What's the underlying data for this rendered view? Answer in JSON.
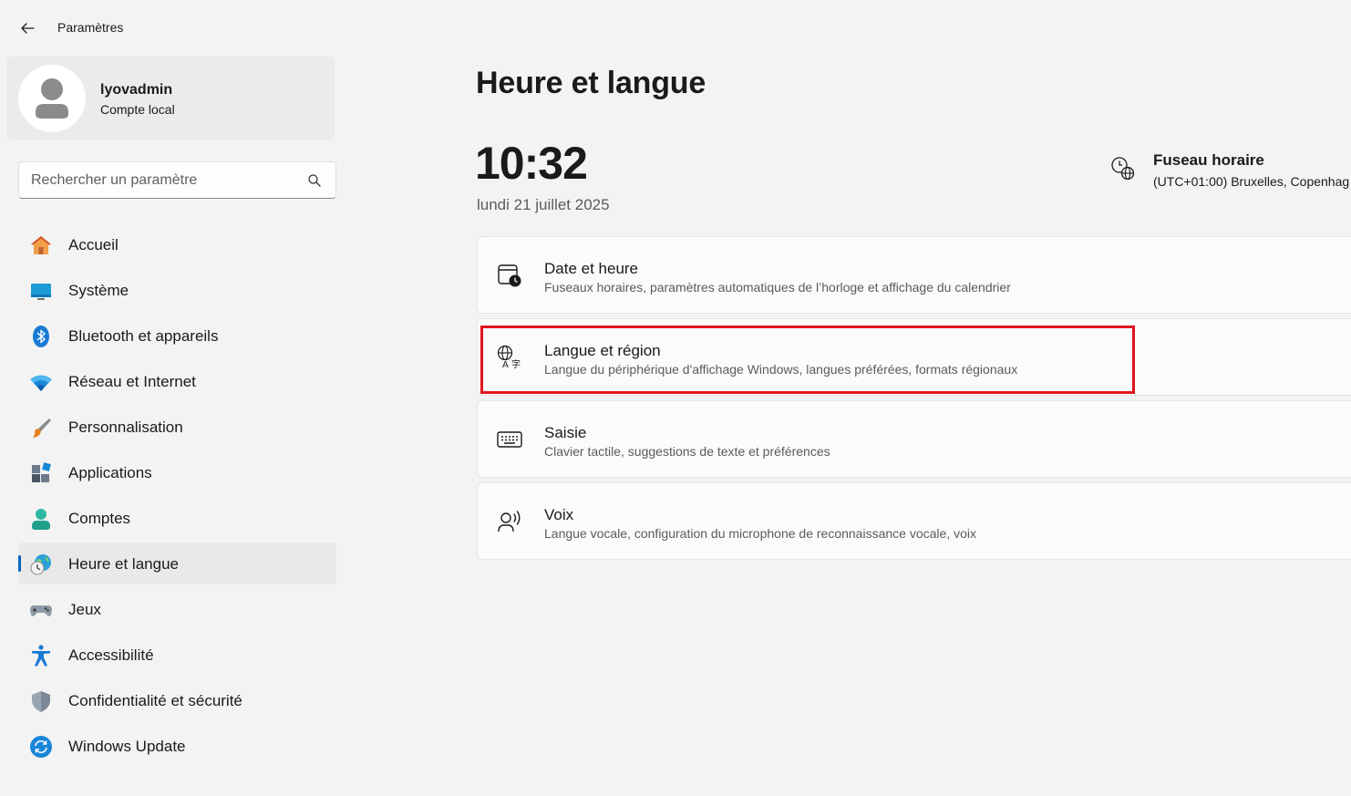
{
  "app": {
    "title": "Paramètres",
    "back_icon": "back-arrow-icon"
  },
  "profile": {
    "name": "lyovadmin",
    "account_type": "Compte local"
  },
  "search": {
    "placeholder": "Rechercher un paramètre",
    "value": ""
  },
  "sidebar": {
    "items": [
      {
        "label": "Accueil",
        "icon": "home-icon",
        "active": false
      },
      {
        "label": "Système",
        "icon": "display-icon",
        "active": false
      },
      {
        "label": "Bluetooth et appareils",
        "icon": "bluetooth-icon",
        "active": false
      },
      {
        "label": "Réseau et Internet",
        "icon": "wifi-icon",
        "active": false
      },
      {
        "label": "Personnalisation",
        "icon": "brush-icon",
        "active": false
      },
      {
        "label": "Applications",
        "icon": "apps-icon",
        "active": false
      },
      {
        "label": "Comptes",
        "icon": "person-icon",
        "active": false
      },
      {
        "label": "Heure et langue",
        "icon": "globe-clock-icon",
        "active": true
      },
      {
        "label": "Jeux",
        "icon": "gamepad-icon",
        "active": false
      },
      {
        "label": "Accessibilité",
        "icon": "accessibility-icon",
        "active": false
      },
      {
        "label": "Confidentialité et sécurité",
        "icon": "shield-icon",
        "active": false
      },
      {
        "label": "Windows Update",
        "icon": "update-icon",
        "active": false
      }
    ]
  },
  "main": {
    "title": "Heure et langue",
    "time": "10:32",
    "date": "lundi 21 juillet 2025",
    "timezone": {
      "title": "Fuseau horaire",
      "value": "(UTC+01:00) Bruxelles, Copenhag"
    },
    "cards": [
      {
        "title": "Date et heure",
        "subtitle": "Fuseaux horaires, paramètres automatiques de l’horloge et affichage du calendrier",
        "icon": "calendar-clock-icon"
      },
      {
        "title": "Langue et région",
        "subtitle": "Langue du périphérique d'affichage Windows, langues préférées, formats régionaux",
        "icon": "language-icon"
      },
      {
        "title": "Saisie",
        "subtitle": "Clavier tactile, suggestions de texte et préférences",
        "icon": "keyboard-icon"
      },
      {
        "title": "Voix",
        "subtitle": "Langue vocale, configuration du microphone de reconnaissance vocale, voix",
        "icon": "speech-icon"
      }
    ]
  },
  "colors": {
    "accent": "#0067c0",
    "highlight": "#e0161e",
    "background": "#f3f3f3"
  }
}
